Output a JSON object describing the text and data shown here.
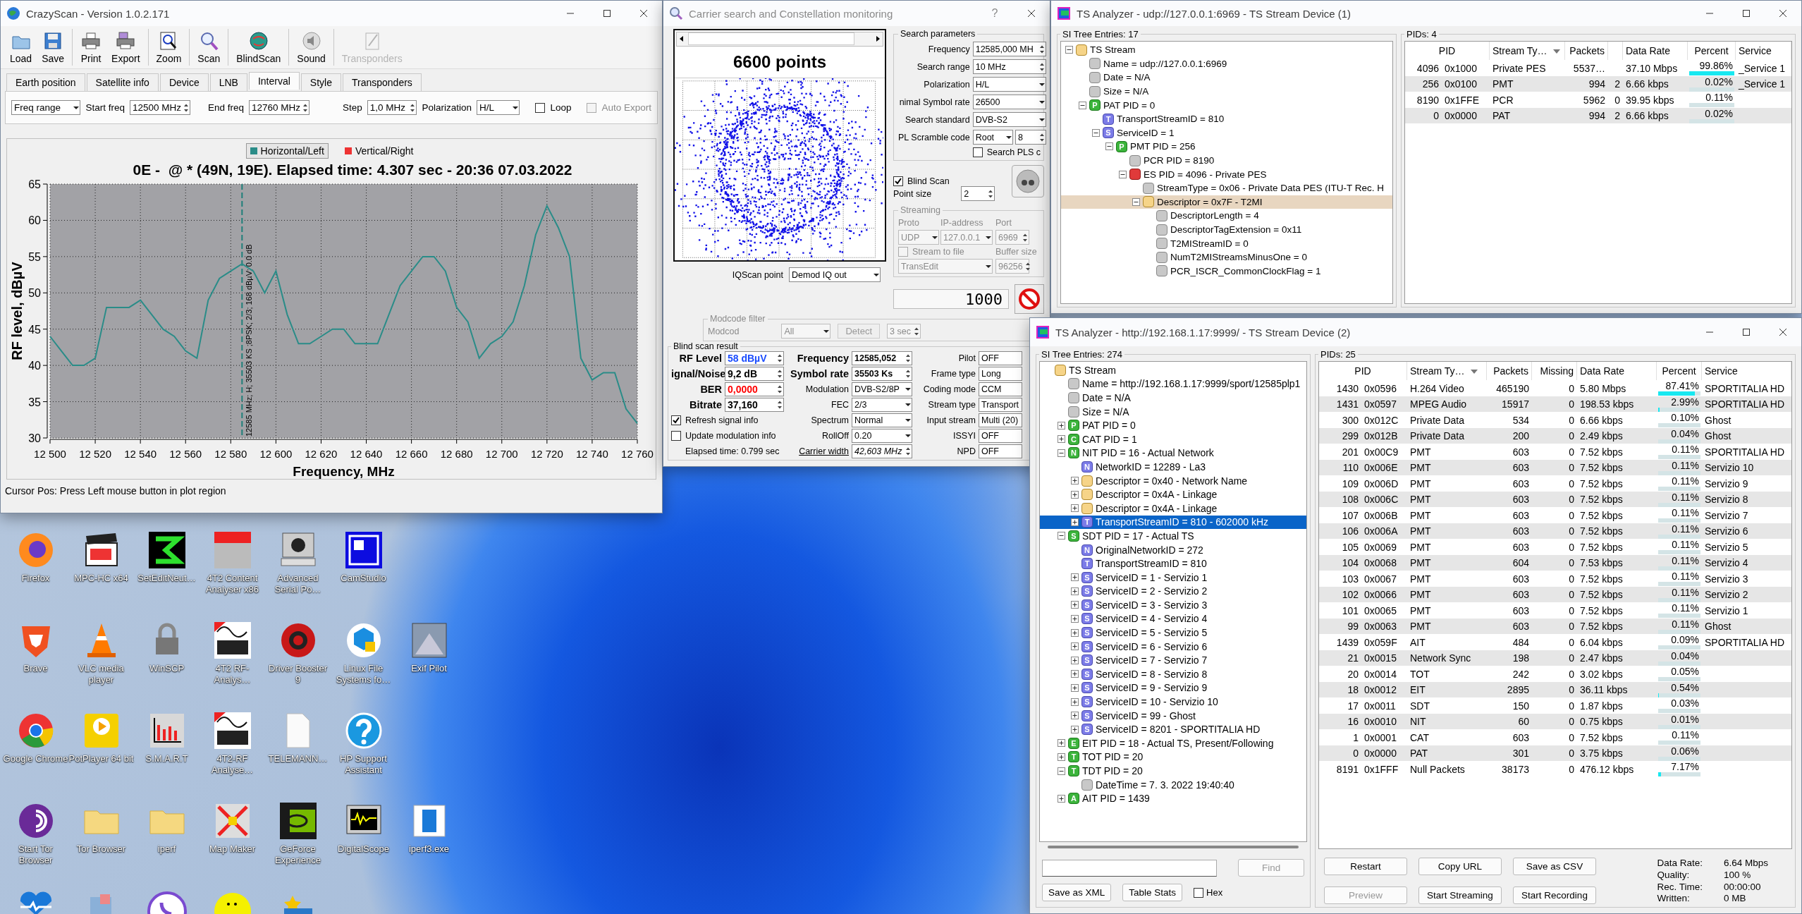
{
  "crazyscan": {
    "title": "CrazyScan - Version 1.0.2.171",
    "toolbar": [
      {
        "label": "Load",
        "disabled": false
      },
      {
        "label": "Save",
        "disabled": false
      },
      {
        "label": "Print",
        "disabled": false
      },
      {
        "label": "Export",
        "disabled": false
      },
      {
        "label": "Zoom",
        "disabled": false
      },
      {
        "label": "Scan",
        "disabled": false
      },
      {
        "label": "BlindScan",
        "disabled": false
      },
      {
        "label": "Sound",
        "disabled": false
      },
      {
        "label": "Transponders",
        "disabled": true
      }
    ],
    "tabs": [
      {
        "label": "Earth position",
        "selected": false
      },
      {
        "label": "Satellite info",
        "selected": false
      },
      {
        "label": "Device",
        "selected": false
      },
      {
        "label": "LNB",
        "selected": false
      },
      {
        "label": "Interval",
        "selected": true
      },
      {
        "label": "Style",
        "selected": false
      },
      {
        "label": "Transponders",
        "selected": false
      }
    ],
    "interval": {
      "mode": "Freq range",
      "start_label": "Start freq",
      "start": "12500 MHz",
      "end_label": "End freq",
      "end": "12760 MHz",
      "step_label": "Step",
      "step": "1,0 MHz",
      "polarization_label": "Polarization",
      "polarization": "H/L",
      "options": [
        {
          "label": "Loop",
          "checked": false,
          "disabled": false
        },
        {
          "label": "Auto Export",
          "checked": false,
          "disabled": true
        }
      ]
    },
    "chart_data": {
      "type": "line",
      "title": "0E -  @ * (49N, 19E). Elapsed time: 4.307 sec - 20:36 07.03.2022",
      "xlabel": "Frequency, MHz",
      "ylabel": "RF level, dBµV",
      "x": [
        12500,
        12505,
        12510,
        12515,
        12520,
        12525,
        12530,
        12535,
        12540,
        12545,
        12550,
        12555,
        12560,
        12565,
        12570,
        12575,
        12580,
        12585,
        12590,
        12595,
        12600,
        12605,
        12610,
        12615,
        12620,
        12625,
        12630,
        12635,
        12640,
        12645,
        12650,
        12655,
        12660,
        12665,
        12670,
        12675,
        12680,
        12685,
        12690,
        12695,
        12700,
        12705,
        12710,
        12715,
        12720,
        12725,
        12730,
        12735,
        12740,
        12745,
        12750,
        12755,
        12760
      ],
      "series": [
        {
          "name": "Horizontal/Left",
          "color": "#2a8c88",
          "values": [
            44,
            42,
            40,
            40,
            41,
            48,
            48,
            48,
            49,
            47,
            45,
            44,
            42,
            41,
            49,
            52,
            53,
            54,
            53,
            50,
            53,
            47,
            43,
            43,
            44,
            45,
            45,
            43,
            43,
            43,
            47,
            51,
            53,
            55,
            55,
            53,
            48,
            46,
            41,
            43,
            44,
            46,
            51,
            58,
            62,
            59,
            55,
            41,
            38,
            39,
            39,
            34,
            32
          ]
        },
        {
          "name": "Vertical/Right",
          "color": "#ee3333",
          "values": [
            null,
            null,
            null,
            null,
            null,
            null,
            null,
            null,
            null,
            null,
            null,
            null,
            null,
            null,
            null,
            null,
            null,
            null,
            null,
            null,
            null,
            null,
            null,
            null,
            null,
            null,
            null,
            null,
            null,
            null,
            null,
            null,
            null,
            null,
            null,
            null,
            null,
            null,
            null,
            null,
            null,
            null,
            null,
            null,
            null,
            null,
            null,
            null,
            null,
            null,
            null,
            null,
            null
          ]
        }
      ],
      "xlim": [
        12500,
        12760
      ],
      "ylim": [
        30,
        65
      ],
      "xticks": [
        {
          "value": 12500,
          "label": "12 500"
        },
        {
          "value": 12520,
          "label": "12 520"
        },
        {
          "value": 12540,
          "label": "12 540"
        },
        {
          "value": 12560,
          "label": "12 560"
        },
        {
          "value": 12580,
          "label": "12 580"
        },
        {
          "value": 12600,
          "label": "12 600"
        },
        {
          "value": 12620,
          "label": "12 620"
        },
        {
          "value": 12640,
          "label": "12 640"
        },
        {
          "value": 12660,
          "label": "12 660"
        },
        {
          "value": 12680,
          "label": "12 680"
        },
        {
          "value": 12700,
          "label": "12 700"
        },
        {
          "value": 12720,
          "label": "12 720"
        },
        {
          "value": 12740,
          "label": "12 740"
        },
        {
          "value": 12760,
          "label": "12 760"
        }
      ],
      "yticks": [
        30,
        35,
        40,
        45,
        50,
        55,
        60,
        65
      ],
      "grid": true,
      "ref_lines": [
        {
          "axis": "x",
          "value": 12585,
          "label": "12585 MHz; H; 35503 KS ;8PSK; 2/3; 168 dBµV; 0.0 dB"
        }
      ]
    },
    "status": "Cursor Pos: Press Left mouse button in plot region"
  },
  "carrier": {
    "title": "Carrier search and Constellation monitoring",
    "help": "?",
    "points": "6600 points",
    "search": {
      "title": "Search parameters",
      "rows": [
        {
          "label": "Frequency",
          "controls": [
            {
              "kind": "spin",
              "value": "12585,000 MH"
            }
          ]
        },
        {
          "label": "Search range",
          "controls": [
            {
              "kind": "spin",
              "value": "10 MHz"
            }
          ]
        },
        {
          "label": "Polarization",
          "controls": [
            {
              "kind": "combo",
              "value": "H/L"
            }
          ]
        },
        {
          "label": "nimal Symbol rate",
          "controls": [
            {
              "kind": "combo",
              "value": "26500"
            }
          ]
        },
        {
          "label": "Search standard",
          "controls": [
            {
              "kind": "combo",
              "value": "DVB-S2"
            }
          ]
        },
        {
          "label": "PL Scramble code",
          "controls": [
            {
              "kind": "combo",
              "value": "Root"
            },
            {
              "kind": "spin",
              "value": "8"
            }
          ]
        }
      ],
      "pls": {
        "label": "Search PLS c",
        "checked": false
      }
    },
    "blind_scan": {
      "label": "Blind Scan",
      "checked": true
    },
    "point_size": {
      "label": "Point size",
      "value": "2"
    },
    "streaming": {
      "title": "Streaming",
      "disabled": true,
      "proto_label": "Proto",
      "ip_label": "IP-address",
      "port_label": "Port",
      "proto": "UDP",
      "ip": "127.0.0.1",
      "port": "6969",
      "to_file": {
        "label": "Stream to file",
        "checked": false
      },
      "buffer_label": "Buffer size",
      "target": "TransEdit",
      "buffer": "96256"
    },
    "counter": "1000",
    "iq": {
      "label": "IQScan point",
      "value": "Demod IQ out"
    },
    "modcode": {
      "title": "Modcode filter",
      "label": "Modcod",
      "value": "All",
      "detect": "Detect",
      "timeout": "3 sec",
      "disabled": true
    },
    "result": {
      "title": "Blind scan result",
      "signal": [
        {
          "label": "RF Level",
          "value": "58 dBµV",
          "color": "#1a4cff"
        },
        {
          "label": "ignal/Noise",
          "value": "9,2 dB",
          "color": "#000000"
        },
        {
          "label": "BER",
          "value": "0,0000",
          "color": "#ff0000"
        },
        {
          "label": "Bitrate",
          "value": "37,160",
          "color": "#000000"
        }
      ],
      "options": [
        {
          "label": "Refresh signal info",
          "checked": true
        },
        {
          "label": "Update modulation info",
          "checked": false
        }
      ],
      "elapsed": "Elapsed time: 0.799 sec",
      "params": [
        {
          "label": "Frequency",
          "value": "12585,052",
          "kind": "key"
        },
        {
          "label": "Symbol rate",
          "value": "35503 Ks",
          "kind": "key"
        },
        {
          "label": "Modulation",
          "value": "DVB-S2/8P",
          "kind": "combo"
        },
        {
          "label": "FEC",
          "value": "2/3",
          "kind": "combo"
        },
        {
          "label": "Spectrum",
          "value": "Normal",
          "kind": "combo"
        },
        {
          "label": "RollOff",
          "value": "0.20",
          "kind": "combo"
        },
        {
          "label": "Carrier width",
          "value": "42,603 MHz",
          "kind": "link"
        }
      ],
      "flags": [
        {
          "label": "Pilot",
          "value": "OFF"
        },
        {
          "label": "Frame type",
          "value": "Long"
        },
        {
          "label": "Coding mode",
          "value": "CCM"
        },
        {
          "label": "Stream type",
          "value": "Transport"
        },
        {
          "label": "Input stream",
          "value": "Multi (20)"
        },
        {
          "label": "ISSYI",
          "value": "OFF"
        },
        {
          "label": "NPD",
          "value": "OFF"
        }
      ]
    }
  },
  "ts1": {
    "title": "TS Analyzer - udp://127.0.0.1:6969 - TS Stream Device (1)",
    "tree_title": "SI Tree Entries: 17",
    "tree": [
      {
        "label": "TS Stream",
        "kind": "folder",
        "expanded": true,
        "selected": false,
        "children": [
          {
            "label": "Name = udp://127.0.0.1:6969",
            "kind": "leaf",
            "selected": false
          },
          {
            "label": "Date = N/A",
            "kind": "leaf",
            "selected": false
          },
          {
            "label": "Size = N/A",
            "kind": "leaf",
            "selected": false
          },
          {
            "label": "PAT PID = 0",
            "kind": "table",
            "badge": "P",
            "expanded": true,
            "selected": false,
            "children": [
              {
                "label": "TransportStreamID = 810",
                "kind": "id",
                "badge": "T",
                "selected": false
              },
              {
                "label": "ServiceID = 1",
                "kind": "id",
                "badge": "S",
                "expanded": true,
                "selected": false,
                "children": [
                  {
                    "label": "PMT PID = 256",
                    "kind": "table",
                    "badge": "P",
                    "expanded": true,
                    "selected": false,
                    "children": [
                      {
                        "label": "PCR PID = 8190",
                        "kind": "leaf",
                        "selected": false
                      },
                      {
                        "label": "ES PID = 4096 - Private PES",
                        "kind": "stream",
                        "expanded": true,
                        "selected": false,
                        "children": [
                          {
                            "label": "StreamType = 0x06 - Private Data PES (ITU-T Rec. H",
                            "kind": "leaf",
                            "selected": false
                          },
                          {
                            "label": "Descriptor = 0x7F - T2MI",
                            "kind": "folder",
                            "expanded": true,
                            "selected": true,
                            "children": [
                              {
                                "label": "DescriptorLength = 4",
                                "kind": "leaf",
                                "selected": false
                              },
                              {
                                "label": "DescriptorTagExtension = 0x11",
                                "kind": "leaf",
                                "selected": false
                              },
                              {
                                "label": "T2MIStreamID = 0",
                                "kind": "leaf",
                                "selected": false
                              },
                              {
                                "label": "NumT2MIStreamsMinusOne = 0",
                                "kind": "leaf",
                                "selected": false
                              },
                              {
                                "label": "PCR_ISCR_CommonClockFlag = 1",
                                "kind": "leaf",
                                "selected": false
                              }
                            ]
                          }
                        ]
                      }
                    ]
                  }
                ]
              }
            ]
          }
        ]
      }
    ],
    "table_title": "PIDs: 4",
    "columns": {
      "pid": "PID",
      "type": "Stream Ty…",
      "packets": "Packets",
      "rate": "Data Rate",
      "percent": "Percent",
      "service": "Service"
    },
    "rows": [
      {
        "pid": "4096",
        "hex": "0x1000",
        "type": "Private PES",
        "packets": "5537…",
        "rate": "37.10 Mbps",
        "percent": "99.86%",
        "level": 0.9986,
        "service": "_Service 1"
      },
      {
        "pid": "256",
        "hex": "0x0100",
        "type": "PMT",
        "packets": "994",
        "missing": "2",
        "rate": "6.66 kbps",
        "percent": "0.02%",
        "level": 0.0002,
        "service": "_Service 1"
      },
      {
        "pid": "8190",
        "hex": "0x1FFE",
        "type": "PCR",
        "packets": "5962",
        "missing": "0",
        "rate": "39.95 kbps",
        "percent": "0.11%",
        "level": 0.0011
      },
      {
        "pid": "0",
        "hex": "0x0000",
        "type": "PAT",
        "packets": "994",
        "missing": "2",
        "rate": "6.66 kbps",
        "percent": "0.02%",
        "level": 0.0002
      }
    ]
  },
  "ts2": {
    "title": "TS Analyzer - http://192.168.1.17:9999/ - TS Stream Device (2)",
    "tree_title": "SI Tree Entries: 274",
    "tree": [
      {
        "label": "TS Stream",
        "kind": "folder",
        "selected": false,
        "children": [
          {
            "label": "Name = http://192.168.1.17:9999/sport/12585plp1",
            "kind": "leaf",
            "selected": false
          },
          {
            "label": "Date = N/A",
            "kind": "leaf",
            "selected": false
          },
          {
            "label": "Size = N/A",
            "kind": "leaf",
            "selected": false
          },
          {
            "label": "PAT PID = 0",
            "kind": "table",
            "badge": "P",
            "expanded": false,
            "selected": false
          },
          {
            "label": "CAT PID = 1",
            "kind": "table",
            "badge": "C",
            "expanded": false,
            "selected": false
          },
          {
            "label": "NIT PID = 16 - Actual Network",
            "kind": "table",
            "badge": "N",
            "expanded": true,
            "selected": false,
            "children": [
              {
                "label": "NetworkID = 12289 - La3",
                "kind": "id",
                "badge": "N",
                "selected": false
              },
              {
                "label": "Descriptor = 0x40 - Network Name",
                "kind": "folder",
                "expanded": false,
                "selected": false
              },
              {
                "label": "Descriptor = 0x4A - Linkage",
                "kind": "folder",
                "expanded": false,
                "selected": false
              },
              {
                "label": "Descriptor = 0x4A - Linkage",
                "kind": "folder",
                "expanded": false,
                "selected": false
              },
              {
                "label": "TransportStreamID = 810 - 602000 kHz",
                "kind": "id",
                "badge": "T",
                "expanded": false,
                "selected": true
              }
            ]
          },
          {
            "label": "SDT PID = 17 - Actual TS",
            "kind": "table",
            "badge": "S",
            "expanded": true,
            "selected": false,
            "children": [
              {
                "label": "OriginalNetworkID = 272",
                "kind": "id",
                "badge": "N",
                "selected": false
              },
              {
                "label": "TransportStreamID = 810",
                "kind": "id",
                "badge": "T",
                "selected": false
              },
              {
                "label": "ServiceID = 1 - Servizio 1",
                "kind": "id",
                "badge": "S",
                "expanded": false,
                "selected": false
              },
              {
                "label": "ServiceID = 2 - Servizio 2",
                "kind": "id",
                "badge": "S",
                "expanded": false,
                "selected": false
              },
              {
                "label": "ServiceID = 3 - Servizio 3",
                "kind": "id",
                "badge": "S",
                "expanded": false,
                "selected": false
              },
              {
                "label": "ServiceID = 4 - Servizio 4",
                "kind": "id",
                "badge": "S",
                "expanded": false,
                "selected": false
              },
              {
                "label": "ServiceID = 5 - Servizio 5",
                "kind": "id",
                "badge": "S",
                "expanded": false,
                "selected": false
              },
              {
                "label": "ServiceID = 6 - Servizio 6",
                "kind": "id",
                "badge": "S",
                "expanded": false,
                "selected": false
              },
              {
                "label": "ServiceID = 7 - Servizio 7",
                "kind": "id",
                "badge": "S",
                "expanded": false,
                "selected": false
              },
              {
                "label": "ServiceID = 8 - Servizio 8",
                "kind": "id",
                "badge": "S",
                "expanded": false,
                "selected": false
              },
              {
                "label": "ServiceID = 9 - Servizio 9",
                "kind": "id",
                "badge": "S",
                "expanded": false,
                "selected": false
              },
              {
                "label": "ServiceID = 10 - Servizio 10",
                "kind": "id",
                "badge": "S",
                "expanded": false,
                "selected": false
              },
              {
                "label": "ServiceID = 99 - Ghost",
                "kind": "id",
                "badge": "S",
                "expanded": false,
                "selected": false
              },
              {
                "label": "ServiceID = 8201 - SPORTITALIA HD",
                "kind": "id",
                "badge": "S",
                "expanded": false,
                "selected": false
              }
            ]
          },
          {
            "label": "EIT PID = 18 - Actual TS, Present/Following",
            "kind": "table",
            "badge": "E",
            "expanded": false,
            "selected": false
          },
          {
            "label": "TOT PID = 20",
            "kind": "table",
            "badge": "T",
            "expanded": false,
            "selected": false
          },
          {
            "label": "TDT PID = 20",
            "kind": "table",
            "badge": "T",
            "expanded": true,
            "selected": false,
            "children": [
              {
                "label": "DateTime = 7. 3. 2022 19:40:40",
                "kind": "leaf",
                "selected": false
              }
            ]
          },
          {
            "label": "AIT PID = 1439",
            "kind": "table",
            "badge": "A",
            "expanded": false,
            "selected": false
          }
        ]
      }
    ],
    "find": {
      "button": "Find",
      "disabled": true
    },
    "tree_buttons": [
      "Save as XML",
      "Table Stats"
    ],
    "hex": {
      "label": "Hex",
      "checked": false
    },
    "table_title": "PIDs: 25",
    "columns": {
      "pid": "PID",
      "type": "Stream Ty…",
      "packets": "Packets",
      "missing": "Missing",
      "rate": "Data Rate",
      "percent": "Percent",
      "service": "Service"
    },
    "rows": [
      {
        "pid": "1430",
        "hex": "0x0596",
        "type": "H.264 Video",
        "packets": "465190",
        "missing": "0",
        "rate": "5.80 Mbps",
        "percent": "87.41%",
        "level": 0.8741,
        "service": "SPORTITALIA HD"
      },
      {
        "pid": "1431",
        "hex": "0x0597",
        "type": "MPEG Audio",
        "packets": "15917",
        "missing": "0",
        "rate": "198.53 kbps",
        "percent": "2.99%",
        "level": 0.0299,
        "service": "SPORTITALIA HD"
      },
      {
        "pid": "300",
        "hex": "0x012C",
        "type": "Private Data",
        "packets": "534",
        "missing": "0",
        "rate": "6.66 kbps",
        "percent": "0.10%",
        "level": 0.001,
        "service": "Ghost"
      },
      {
        "pid": "299",
        "hex": "0x012B",
        "type": "Private Data",
        "packets": "200",
        "missing": "0",
        "rate": "2.49 kbps",
        "percent": "0.04%",
        "level": 0.0004,
        "service": "Ghost"
      },
      {
        "pid": "201",
        "hex": "0x00C9",
        "type": "PMT",
        "packets": "603",
        "missing": "0",
        "rate": "7.52 kbps",
        "percent": "0.11%",
        "level": 0.0011,
        "service": "SPORTITALIA HD"
      },
      {
        "pid": "110",
        "hex": "0x006E",
        "type": "PMT",
        "packets": "603",
        "missing": "0",
        "rate": "7.52 kbps",
        "percent": "0.11%",
        "level": 0.0011,
        "service": "Servizio 10"
      },
      {
        "pid": "109",
        "hex": "0x006D",
        "type": "PMT",
        "packets": "603",
        "missing": "0",
        "rate": "7.52 kbps",
        "percent": "0.11%",
        "level": 0.0011,
        "service": "Servizio 9"
      },
      {
        "pid": "108",
        "hex": "0x006C",
        "type": "PMT",
        "packets": "603",
        "missing": "0",
        "rate": "7.52 kbps",
        "percent": "0.11%",
        "level": 0.0011,
        "service": "Servizio 8"
      },
      {
        "pid": "107",
        "hex": "0x006B",
        "type": "PMT",
        "packets": "603",
        "missing": "0",
        "rate": "7.52 kbps",
        "percent": "0.11%",
        "level": 0.0011,
        "service": "Servizio 7"
      },
      {
        "pid": "106",
        "hex": "0x006A",
        "type": "PMT",
        "packets": "603",
        "missing": "0",
        "rate": "7.52 kbps",
        "percent": "0.11%",
        "level": 0.0011,
        "service": "Servizio 6"
      },
      {
        "pid": "105",
        "hex": "0x0069",
        "type": "PMT",
        "packets": "603",
        "missing": "0",
        "rate": "7.52 kbps",
        "percent": "0.11%",
        "level": 0.0011,
        "service": "Servizio 5"
      },
      {
        "pid": "104",
        "hex": "0x0068",
        "type": "PMT",
        "packets": "604",
        "missing": "0",
        "rate": "7.53 kbps",
        "percent": "0.11%",
        "level": 0.0011,
        "service": "Servizio 4"
      },
      {
        "pid": "103",
        "hex": "0x0067",
        "type": "PMT",
        "packets": "603",
        "missing": "0",
        "rate": "7.52 kbps",
        "percent": "0.11%",
        "level": 0.0011,
        "service": "Servizio 3"
      },
      {
        "pid": "102",
        "hex": "0x0066",
        "type": "PMT",
        "packets": "603",
        "missing": "0",
        "rate": "7.52 kbps",
        "percent": "0.11%",
        "level": 0.0011,
        "service": "Servizio 2"
      },
      {
        "pid": "101",
        "hex": "0x0065",
        "type": "PMT",
        "packets": "603",
        "missing": "0",
        "rate": "7.52 kbps",
        "percent": "0.11%",
        "level": 0.0011,
        "service": "Servizio 1"
      },
      {
        "pid": "99",
        "hex": "0x0063",
        "type": "PMT",
        "packets": "603",
        "missing": "0",
        "rate": "7.52 kbps",
        "percent": "0.11%",
        "level": 0.0011,
        "service": "Ghost"
      },
      {
        "pid": "1439",
        "hex": "0x059F",
        "type": "AIT",
        "packets": "484",
        "missing": "0",
        "rate": "6.04 kbps",
        "percent": "0.09%",
        "level": 0.0009,
        "service": "SPORTITALIA HD"
      },
      {
        "pid": "21",
        "hex": "0x0015",
        "type": "Network Sync",
        "packets": "198",
        "missing": "0",
        "rate": "2.47 kbps",
        "percent": "0.04%",
        "level": 0.0004
      },
      {
        "pid": "20",
        "hex": "0x0014",
        "type": "TOT",
        "packets": "242",
        "missing": "0",
        "rate": "3.02 kbps",
        "percent": "0.05%",
        "level": 0.0005
      },
      {
        "pid": "18",
        "hex": "0x0012",
        "type": "EIT",
        "packets": "2895",
        "missing": "0",
        "rate": "36.11 kbps",
        "percent": "0.54%",
        "level": 0.0054
      },
      {
        "pid": "17",
        "hex": "0x0011",
        "type": "SDT",
        "packets": "150",
        "missing": "0",
        "rate": "1.87 kbps",
        "percent": "0.03%",
        "level": 0.0003
      },
      {
        "pid": "16",
        "hex": "0x0010",
        "type": "NIT",
        "packets": "60",
        "missing": "0",
        "rate": "0.75 kbps",
        "percent": "0.01%",
        "level": 0.0001
      },
      {
        "pid": "1",
        "hex": "0x0001",
        "type": "CAT",
        "packets": "603",
        "missing": "0",
        "rate": "7.52 kbps",
        "percent": "0.11%",
        "level": 0.0011
      },
      {
        "pid": "0",
        "hex": "0x0000",
        "type": "PAT",
        "packets": "301",
        "missing": "0",
        "rate": "3.75 kbps",
        "percent": "0.06%",
        "level": 0.0006
      },
      {
        "pid": "8191",
        "hex": "0x1FFF",
        "type": "Null Packets",
        "packets": "38173",
        "missing": "0",
        "rate": "476.12 kbps",
        "percent": "7.17%",
        "level": 0.0717
      }
    ],
    "buttons": [
      {
        "label": "Restart",
        "disabled": false
      },
      {
        "label": "Copy URL",
        "disabled": false
      },
      {
        "label": "Save as CSV",
        "disabled": false
      },
      {
        "label": "Preview",
        "disabled": true
      },
      {
        "label": "Start Streaming",
        "disabled": false
      },
      {
        "label": "Start Recording",
        "disabled": false
      }
    ],
    "stats": [
      {
        "label": "Data Rate:",
        "value": "6.64 Mbps"
      },
      {
        "label": "Quality:",
        "value": "100 %"
      },
      {
        "label": "Rec. Time:",
        "value": "00:00:00"
      },
      {
        "label": "Written:",
        "value": "0 MB"
      }
    ]
  },
  "desktop": {
    "rows": [
      [
        {
          "label": "Firefox"
        },
        {
          "label": "MPC-HC x64"
        },
        {
          "label": "SetEditNeut…"
        },
        {
          "label": "4T2 Content Analyser x86"
        },
        {
          "label": "Advanced Serial Po…"
        },
        {
          "label": "CamStudio"
        }
      ],
      [
        {
          "label": "Brave"
        },
        {
          "label": "VLC media player"
        },
        {
          "label": "WinSCP"
        },
        {
          "label": "4T2 RF-Analys…"
        },
        {
          "label": "Driver Booster 9"
        },
        {
          "label": "Linux File Systems fo…"
        },
        {
          "label": "Exif Pilot"
        }
      ],
      [
        {
          "label": "Google Chrome"
        },
        {
          "label": "PotPlayer 64 bit"
        },
        {
          "label": "S.M.A.R.T"
        },
        {
          "label": "4T2-RF Analyse…"
        },
        {
          "label": "TELEMANN…"
        },
        {
          "label": "HP Support Assistant"
        }
      ],
      [
        {
          "label": "Start Tor Browser"
        },
        {
          "label": "Tor Browser"
        },
        {
          "label": "iperf"
        },
        {
          "label": "Map Maker"
        },
        {
          "label": "GeForce Experience"
        },
        {
          "label": "DigitalScope"
        },
        {
          "label": "iperf3.exe"
        }
      ]
    ]
  }
}
